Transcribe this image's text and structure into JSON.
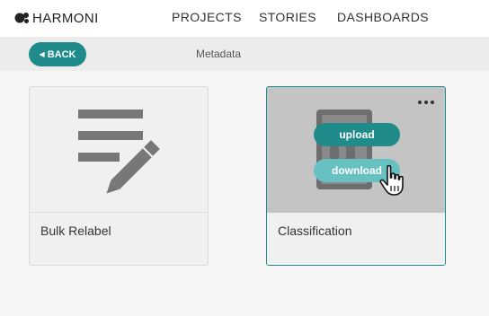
{
  "header": {
    "logo_text": "HARMONI",
    "nav": [
      {
        "label": "PROJECTS"
      },
      {
        "label": "STORIES"
      },
      {
        "label": "DASHBOARDS"
      }
    ]
  },
  "subheader": {
    "back_label": "BACK",
    "breadcrumb": "Metadata"
  },
  "cards": [
    {
      "title": "Bulk Relabel",
      "icon": "pencil-list-icon"
    },
    {
      "title": "Classification",
      "icon": "calculator-icon",
      "actions": {
        "upload": "upload",
        "download": "download"
      },
      "selected": true
    }
  ],
  "colors": {
    "accent": "#1f8b8b",
    "accent_light": "#67c1c3",
    "thumb_bg": "#c4c4c4"
  }
}
